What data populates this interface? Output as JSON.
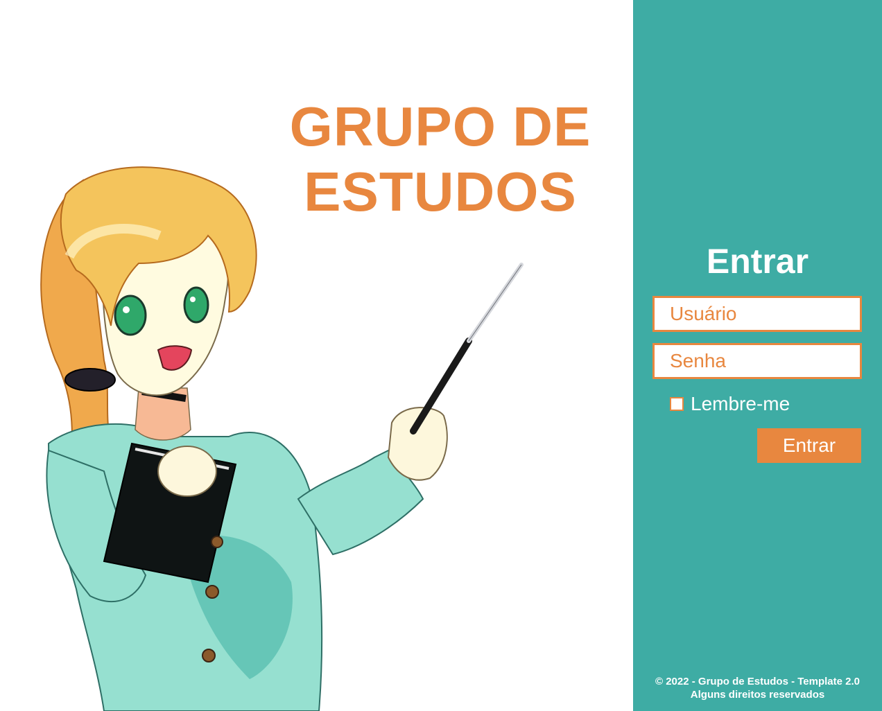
{
  "site": {
    "title_line1": "GRUPO DE",
    "title_line2": "ESTUDOS"
  },
  "login": {
    "heading": "Entrar",
    "username_placeholder": "Usuário",
    "password_placeholder": "Senha",
    "remember_label": "Lembre-me",
    "remember_checked": false,
    "submit_label": "Entrar"
  },
  "footer": {
    "line1": "© 2022 - Grupo de Estudos - Template 2.0",
    "line2": "Alguns direitos reservados"
  },
  "colors": {
    "accent": "#e8873f",
    "sidebar": "#3eaca4",
    "background": "#ffffff"
  }
}
